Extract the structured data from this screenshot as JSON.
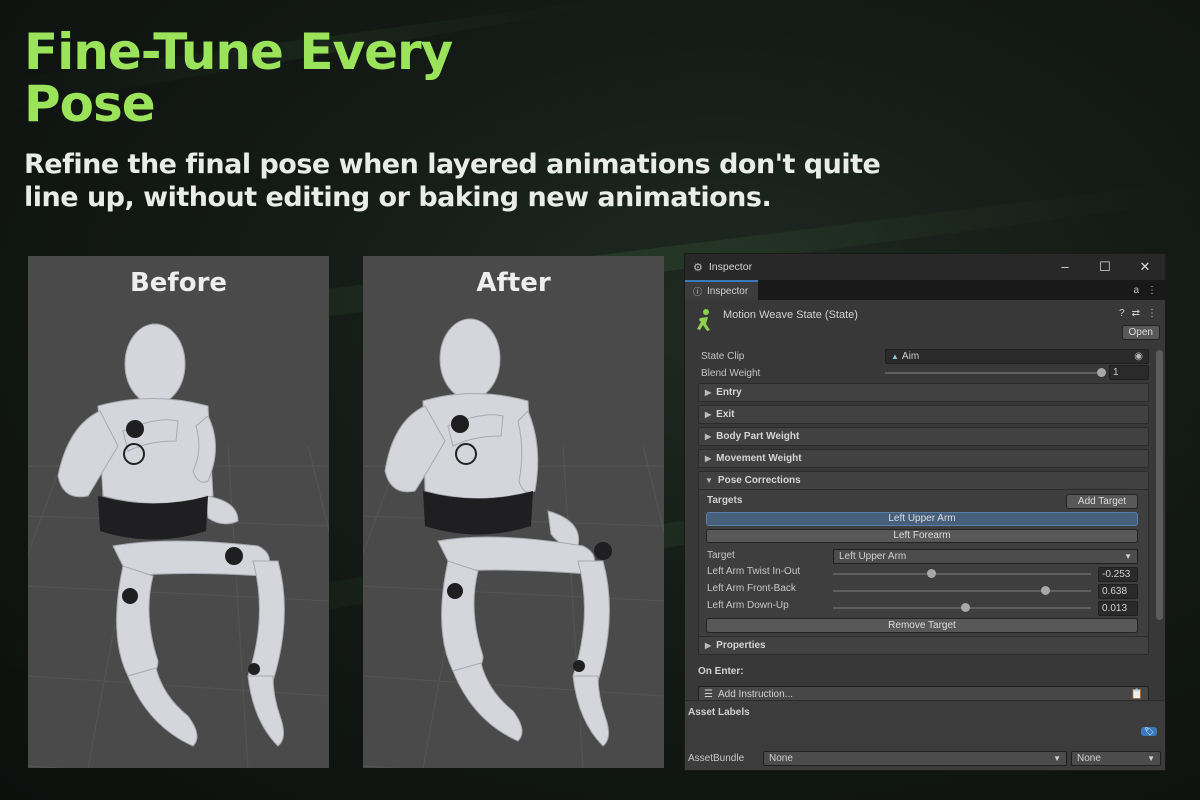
{
  "headline": "Fine-Tune Every Pose",
  "subheadline": "Refine the final pose when layered animations don't quite line up, without editing or baking new animations.",
  "panels": {
    "before": "Before",
    "after": "After"
  },
  "colors": {
    "accent_green": "#9be35a",
    "unity_blue": "#3a79bb",
    "selected_row": "#46607c"
  },
  "inspector": {
    "window_title": "Inspector",
    "window_buttons": [
      "minimize-icon",
      "maximize-icon",
      "close-icon"
    ],
    "tab_label": "Inspector",
    "component_title": "Motion Weave State (State)",
    "open_label": "Open",
    "state_clip_label": "State Clip",
    "state_clip_value": "Aim",
    "blend_weight_label": "Blend Weight",
    "blend_weight_value": "1",
    "blend_weight_fraction": 1.0,
    "sections": {
      "entry": "Entry",
      "exit": "Exit",
      "body_part_weight": "Body Part Weight",
      "movement_weight": "Movement Weight",
      "pose_corrections": "Pose Corrections",
      "properties": "Properties"
    },
    "pose": {
      "targets_label": "Targets",
      "add_target_label": "Add Target",
      "target_items": [
        "Left Upper Arm",
        "Left Forearm"
      ],
      "target_field_label": "Target",
      "target_selected": "Left Upper Arm",
      "sliders": [
        {
          "label": "Left Arm Twist In-Out",
          "value": "-0.253",
          "fraction": 0.38
        },
        {
          "label": "Left Arm Front-Back",
          "value": "0.638",
          "fraction": 0.82
        },
        {
          "label": "Left Arm Down-Up",
          "value": "0.013",
          "fraction": 0.51
        }
      ],
      "remove_target_label": "Remove Target"
    },
    "on_enter_label": "On Enter:",
    "add_instruction_label": "Add Instruction...",
    "asset_labels_title": "Asset Labels",
    "asset_bundle_label": "AssetBundle",
    "asset_bundle_value": "None",
    "asset_variant_value": "None"
  }
}
